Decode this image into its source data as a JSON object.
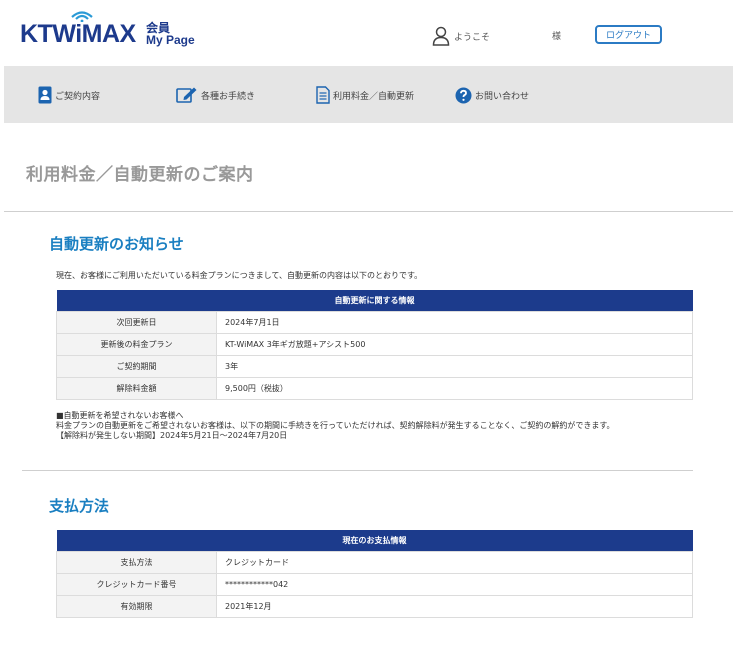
{
  "brand": {
    "logo_main": "KTWiMAX",
    "logo_sub_1": "会員",
    "logo_sub_2": "My Page",
    "accent_color": "#1c3b8c",
    "link_color": "#2b7bc4",
    "heading_color": "#1a7fc1"
  },
  "header": {
    "welcome_label": "ようこそ",
    "user_suffix": "様",
    "logout_label": "ログアウト"
  },
  "nav": {
    "items": [
      {
        "label": "ご契約内容",
        "icon": "contract-card-icon"
      },
      {
        "label": "各種お手続き",
        "icon": "edit-pencil-icon"
      },
      {
        "label": "利用料金／自動更新",
        "icon": "document-icon"
      },
      {
        "label": "お問い合わせ",
        "icon": "question-circle-icon"
      }
    ]
  },
  "page": {
    "title": "利用料金／自動更新のご案内"
  },
  "auto_renewal": {
    "heading": "自動更新のお知らせ",
    "intro": "現在、お客様にご利用いただいている料金プランにつきまして、自動更新の内容は以下のとおりです。",
    "table_caption": "自動更新に関する情報",
    "rows": [
      {
        "key": "次回更新日",
        "value": "2024年7月1日"
      },
      {
        "key": "更新後の料金プラン",
        "value": "KT-WiMAX 3年ギガ放題+アシスト500"
      },
      {
        "key": "ご契約期間",
        "value": "3年"
      },
      {
        "key": "解除料金額",
        "value": "9,500円（税抜）"
      }
    ],
    "notes": [
      "■自動更新を希望されないお客様へ",
      "料金プランの自動更新をご希望されないお客様は、以下の期間に手続きを行っていただければ、契約解除料が発生することなく、ご契約の解約ができます。",
      "【解除料が発生しない期間】2024年5月21日～2024年7月20日"
    ]
  },
  "payment": {
    "heading": "支払方法",
    "table_caption": "現在のお支払情報",
    "rows": [
      {
        "key": "支払方法",
        "value": "クレジットカード"
      },
      {
        "key": "クレジットカード番号",
        "value": "************042"
      },
      {
        "key": "有効期限",
        "value": "2021年12月"
      }
    ]
  }
}
